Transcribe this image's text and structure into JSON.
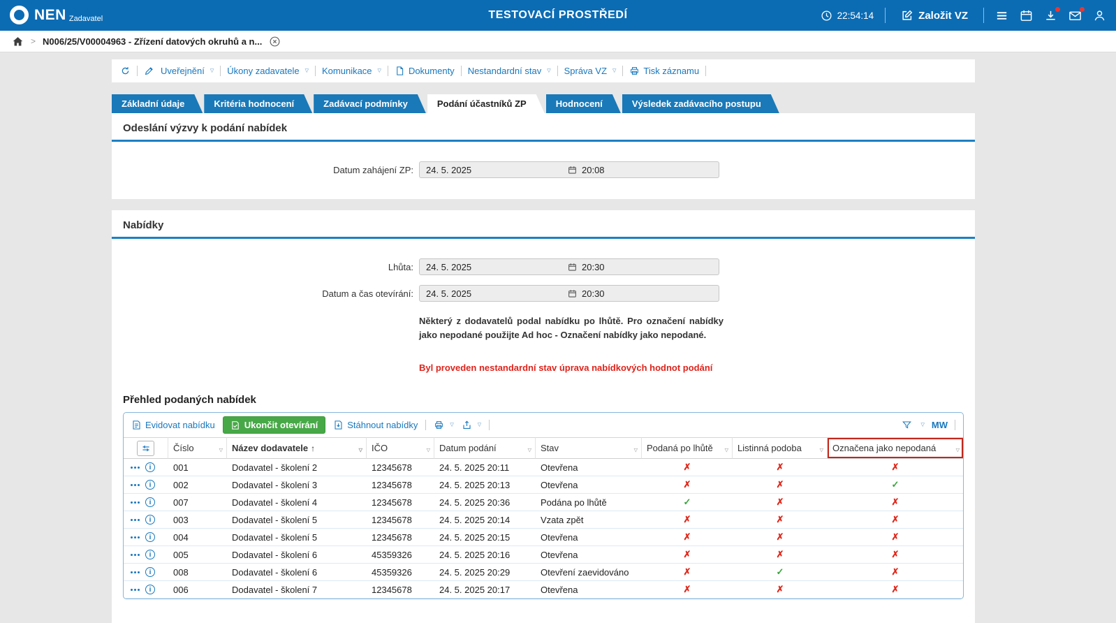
{
  "header": {
    "brand": "NEN",
    "brand_sub": "Zadavatel",
    "env_title": "TESTOVACÍ PROSTŘEDÍ",
    "time": "22:54:14",
    "create_vz_label": "Založit VZ"
  },
  "breadcrumb": {
    "record": "N006/25/V00004963 - Zřízení datových okruhů a n..."
  },
  "toolbar": {
    "uverejneni": "Uveřejnění",
    "ukony": "Úkony zadavatele",
    "komunikace": "Komunikace",
    "dokumenty": "Dokumenty",
    "nestandardni": "Nestandardní stav",
    "sprava": "Správa VZ",
    "tisk": "Tisk záznamu"
  },
  "tabs": [
    {
      "label": "Základní údaje"
    },
    {
      "label": "Kritéria hodnocení"
    },
    {
      "label": "Zadávací podmínky"
    },
    {
      "label": "Podání účastníků ZP"
    },
    {
      "label": "Hodnocení"
    },
    {
      "label": "Výsledek zadávacího postupu"
    }
  ],
  "invitation_section": {
    "title": "Odeslání výzvy k podání nabídek",
    "field_label": "Datum zahájení ZP:",
    "date": "24. 5. 2025",
    "time": "20:08"
  },
  "offers_section": {
    "title": "Nabídky",
    "deadline_label": "Lhůta:",
    "deadline_date": "24. 5. 2025",
    "deadline_time": "20:30",
    "opening_label": "Datum a čas otevírání:",
    "opening_date": "24. 5. 2025",
    "opening_time": "20:30",
    "note": "Některý z dodavatelů podal nabídku po lhůtě. Pro označení nabídky jako nepodané použijte Ad hoc - Označení nabídky jako nepodané.",
    "warning": "Byl proveden nestandardní stav úprava nabídkových hodnot podání"
  },
  "offers_table": {
    "title": "Přehled podaných nabídek",
    "actions": {
      "evidovat": "Evidovat nabídku",
      "ukoncit": "Ukončit otevírání",
      "stahnout": "Stáhnout nabídky",
      "mw": "MW"
    },
    "columns": {
      "cislo": "Číslo",
      "nazev": "Název dodavatele",
      "ico": "IČO",
      "datum": "Datum podání",
      "stav": "Stav",
      "po_lhute": "Podaná po lhůtě",
      "listinna": "Listinná podoba",
      "nepodana": "Označena jako nepodaná"
    },
    "rows": [
      {
        "cislo": "001",
        "nazev": "Dodavatel - školení 2",
        "ico": "12345678",
        "datum": "24. 5. 2025 20:11",
        "stav": "Otevřena",
        "po_lhute": "cross",
        "listinna": "cross",
        "nepodana": "cross"
      },
      {
        "cislo": "002",
        "nazev": "Dodavatel - školení 3",
        "ico": "12345678",
        "datum": "24. 5. 2025 20:13",
        "stav": "Otevřena",
        "po_lhute": "cross",
        "listinna": "cross",
        "nepodana": "check"
      },
      {
        "cislo": "007",
        "nazev": "Dodavatel - školení 4",
        "ico": "12345678",
        "datum": "24. 5. 2025 20:36",
        "stav": "Podána po lhůtě",
        "po_lhute": "check",
        "listinna": "cross",
        "nepodana": "cross"
      },
      {
        "cislo": "003",
        "nazev": "Dodavatel - školení 5",
        "ico": "12345678",
        "datum": "24. 5. 2025 20:14",
        "stav": "Vzata zpět",
        "po_lhute": "cross",
        "listinna": "cross",
        "nepodana": "cross"
      },
      {
        "cislo": "004",
        "nazev": "Dodavatel - školení 5",
        "ico": "12345678",
        "datum": "24. 5. 2025 20:15",
        "stav": "Otevřena",
        "po_lhute": "cross",
        "listinna": "cross",
        "nepodana": "cross"
      },
      {
        "cislo": "005",
        "nazev": "Dodavatel - školení 6",
        "ico": "45359326",
        "datum": "24. 5. 2025 20:16",
        "stav": "Otevřena",
        "po_lhute": "cross",
        "listinna": "cross",
        "nepodana": "cross"
      },
      {
        "cislo": "008",
        "nazev": "Dodavatel - školení 6",
        "ico": "45359326",
        "datum": "24. 5. 2025 20:29",
        "stav": "Otevření zaevidováno",
        "po_lhute": "cross",
        "listinna": "check",
        "nepodana": "cross"
      },
      {
        "cislo": "006",
        "nazev": "Dodavatel - školení 7",
        "ico": "12345678",
        "datum": "24. 5. 2025 20:17",
        "stav": "Otevřena",
        "po_lhute": "cross",
        "listinna": "cross",
        "nepodana": "cross"
      }
    ]
  },
  "colors": {
    "header_blue": "#0b6cb4",
    "tab_blue": "#1a79b8",
    "link_blue": "#1878be",
    "accent_green": "#47a847",
    "status_red": "#e02619",
    "status_green": "#39a53c",
    "warning_red": "#df231b",
    "highlight_border_red": "#c3271b"
  }
}
